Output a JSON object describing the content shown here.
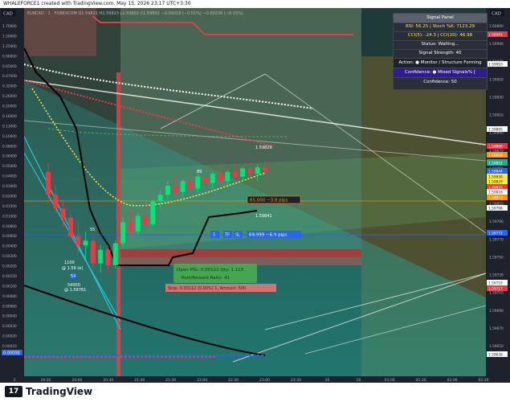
{
  "header": {
    "text": "WHALEFORCE1 created with TradingView.com, May 15, 2026 23:17 UTC+3:30"
  },
  "symbol_line": {
    "text": "EURCAD · 1 · FOREXCOM  O1.59821 H1.59823 L1.59802 C1.59802 −0.00018 (−0.01%)  −0.00236 (−0.15%)"
  },
  "left_scale_unit": "CAD",
  "right_scale_unit": "CAD",
  "footer": {
    "brand": "TradingView",
    "logo_glyph": "17"
  },
  "panel": {
    "title": "Signal Panel",
    "rsi_stoch": "RSI: 56.25 | Stoch %K: 7123.29",
    "cci": "CCI(5): -24.3 | CCI(20): 46.98",
    "status": "Status: Waiting...",
    "strength": "Signal Strength: 40",
    "action": "Action: ● Monitor / Structure Forming",
    "confidence_label": "Confidence: ● Mixed Signals% [",
    "confidence": "Confidence: 50",
    "colors": {
      "title_bg": "#5d606b",
      "action_bg": "#2a2e39",
      "confidence_bg": "#311b92",
      "text": "#ffffff"
    }
  },
  "position_labels": {
    "pos1": "65,000  −3.8 pips",
    "pos2": "69,999  −6.9 pips",
    "tp": "TP",
    "sl": "SL",
    "s": "S",
    "win_box": "Open PSL: 0.00122 Qty: 1.113",
    "win_box2": "Risk/Reward Ratio: 41",
    "loss_box": "Stop: 0.00112 (0.00%) 1, Amount: 500",
    "price_tag": "1.59841",
    "annot_89": "89",
    "annot_55": "55",
    "annot_54": "54",
    "annot_11": "1100",
    "annot_11b": "@ 1.59 (e)",
    "annot_54000": "54000",
    "annot_54000b": "@ 1.59761",
    "top_label": "1.59829"
  },
  "chart_data": {
    "type": "candlestick",
    "title": "",
    "left_axis_ticks": [
      "1.70000",
      "1.50000",
      "1.25000",
      "0.90000",
      "0.65000",
      "0.47000",
      "0.32000",
      "0.26000",
      "0.20000",
      "0.16000",
      "0.13000",
      "0.10000",
      "0.08000",
      "0.06000",
      "0.05000",
      "0.04000",
      "0.03000",
      "0.02000",
      "0.01500",
      "0.01000",
      "0.00800",
      "0.00600",
      "0.00400",
      "0.00300",
      "0.00200",
      "0.00150",
      "0.00100",
      "0.00080",
      "0.00060",
      "0.00040",
      "0.00030",
      "0.00020",
      "0.00010"
    ],
    "left_axis_bottom_label": "0.00000",
    "right_axis_ticks": [
      "1.60000",
      "1.59990",
      "1.59970",
      "1.59950",
      "1.59930",
      "1.59910",
      "1.59890",
      "1.59870",
      "1.59850",
      "1.59830",
      "1.59810",
      "1.59790",
      "1.59770",
      "1.59750",
      "1.59730",
      "1.59710",
      "1.59690",
      "1.59670",
      "1.59650"
    ],
    "right_axis_tags": [
      {
        "label": "1.59991",
        "color": "#f23645"
      },
      {
        "label": "1.59910",
        "color": "#ffffff"
      },
      {
        "label": "High",
        "color": "#1e222d"
      },
      {
        "label": "1.59885",
        "color": "#ffffff"
      },
      {
        "label": "1.59869",
        "color": "#f23645"
      },
      {
        "label": "1.59858",
        "color": "#ff9800"
      },
      {
        "label": "EURCAD",
        "color": "#22ab94"
      },
      {
        "label": "1.59852",
        "color": "#22ab94"
      },
      {
        "label": "1.59844",
        "color": "#2962ff"
      },
      {
        "label": "1.59838",
        "color": "#ffeb3b"
      },
      {
        "label": "1.59829",
        "color": "#ffeb3b"
      },
      {
        "label": "1.59825",
        "color": "#f23645"
      },
      {
        "label": "1.59816",
        "color": "#ffffff"
      },
      {
        "label": "1.59810",
        "color": "#ff9800"
      },
      {
        "label": "1.59798",
        "color": "#ffffff"
      },
      {
        "label": "1.59772",
        "color": "#2962ff"
      },
      {
        "label": "Low",
        "color": "#1e222d"
      },
      {
        "label": "1.59719",
        "color": "#ffffff"
      },
      {
        "label": "1.59717",
        "color": "#f23645"
      },
      {
        "label": "1.59638",
        "color": "#ffffff"
      }
    ],
    "x_ticks": [
      "2",
      "19:30",
      "20:00",
      "20:30",
      "21:00",
      "21:30",
      "22:00",
      "22:30",
      "23:00",
      "23:30",
      "16",
      "18",
      "01:00",
      "01:30",
      "02:00",
      "02:30"
    ],
    "candles": [
      [
        1.5984,
        1.5985,
        1.59805,
        1.59815
      ],
      [
        1.59815,
        1.59825,
        1.59795,
        1.598
      ],
      [
        1.598,
        1.5981,
        1.5978,
        1.5979
      ],
      [
        1.5979,
        1.59795,
        1.59765,
        1.5977
      ],
      [
        1.5977,
        1.59785,
        1.5975,
        1.5976
      ],
      [
        1.5976,
        1.59775,
        1.59745,
        1.59765
      ],
      [
        1.59765,
        1.5977,
        1.59735,
        1.5974
      ],
      [
        1.5974,
        1.5976,
        1.5973,
        1.59755
      ],
      [
        1.59755,
        1.5976,
        1.59732,
        1.59738
      ],
      [
        1.59738,
        1.59765,
        1.59735,
        1.59762
      ],
      [
        1.59762,
        1.5979,
        1.59758,
        1.59785
      ],
      [
        1.59785,
        1.598,
        1.5977,
        1.59775
      ],
      [
        1.59775,
        1.59795,
        1.59772,
        1.59792
      ],
      [
        1.59792,
        1.59805,
        1.5978,
        1.59783
      ],
      [
        1.59783,
        1.5981,
        1.59781,
        1.59808
      ],
      [
        1.59808,
        1.5982,
        1.598,
        1.59815
      ],
      [
        1.59815,
        1.5983,
        1.5981,
        1.59825
      ],
      [
        1.59825,
        1.59835,
        1.59815,
        1.59818
      ],
      [
        1.59818,
        1.59832,
        1.59812,
        1.5983
      ],
      [
        1.5983,
        1.5984,
        1.5982,
        1.59822
      ],
      [
        1.59822,
        1.59838,
        1.59818,
        1.59835
      ],
      [
        1.59835,
        1.59842,
        1.59825,
        1.59828
      ],
      [
        1.59828,
        1.5984,
        1.59822,
        1.59838
      ],
      [
        1.59838,
        1.59845,
        1.59828,
        1.5983
      ],
      [
        1.5983,
        1.59842,
        1.59825,
        1.5984
      ],
      [
        1.5984,
        1.59848,
        1.59832,
        1.59835
      ],
      [
        1.59835,
        1.59846,
        1.5983,
        1.59844
      ],
      [
        1.59844,
        1.5985,
        1.59835,
        1.59838
      ],
      [
        1.59838,
        1.59848,
        1.5983,
        1.59845
      ],
      [
        1.59845,
        1.59852,
        1.59838,
        1.59841
      ]
    ]
  }
}
